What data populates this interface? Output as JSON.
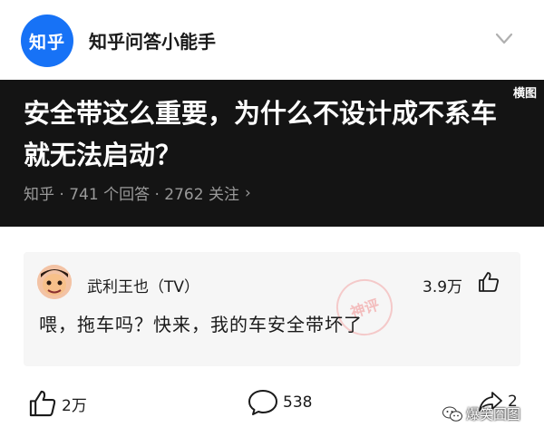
{
  "header": {
    "logo_text": "知乎",
    "account_name": "知乎问答小能手"
  },
  "banner": {
    "tag": "横图",
    "question_title": "安全带这么重要，为什么不设计成不系车就无法启动？",
    "meta": "知乎 · 741 个回答 · 2762 关注",
    "meta_chevron": "›"
  },
  "comment": {
    "username": "武利王也（TV）",
    "likes": "3.9万",
    "text": "喂，拖车吗？快来，我的车安全带坏了",
    "stamp_text": "神评"
  },
  "actions": {
    "like_count": "2万",
    "comment_count": "538",
    "share_count": "2"
  },
  "watermark": {
    "text": "爆笑囧图"
  },
  "colors": {
    "brand_blue": "#1772f6",
    "banner_bg": "#141414",
    "card_bg": "#f6f6f6"
  },
  "icons": [
    "chevron-down-icon",
    "thumbs-up-icon",
    "comment-bubble-icon",
    "share-icon",
    "wechat-icon"
  ]
}
